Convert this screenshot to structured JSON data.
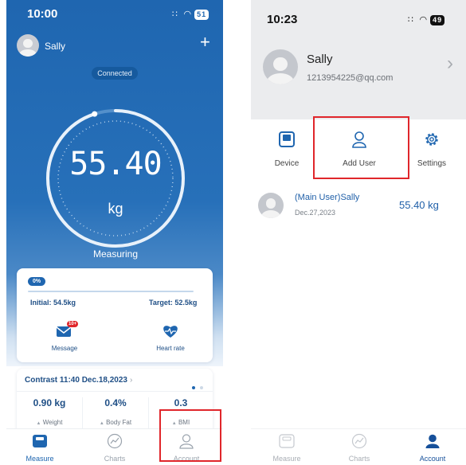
{
  "left": {
    "status": {
      "time": "10:00",
      "signal": "∷ ◠",
      "battery": "51"
    },
    "header": {
      "user_name": "Sally",
      "add_icon": "plus-icon"
    },
    "connection_status": "Connected",
    "gauge": {
      "value": "55.40",
      "unit": "kg",
      "status": "Measuring",
      "progress": 0.95
    },
    "goal": {
      "percent_badge": "0%",
      "progress": 0.0,
      "initial": "Initial: 54.5kg",
      "target": "Target: 52.5kg"
    },
    "shortcuts": [
      {
        "label": "Message",
        "badge": "10+",
        "icon": "envelope-icon"
      },
      {
        "label": "Heart rate",
        "icon": "heart-pulse-icon"
      }
    ],
    "contrast": {
      "title": "Contrast 11:40 Dec.18,2023",
      "chevron": "›",
      "metrics": [
        {
          "value": "0.90 kg",
          "label": "Weight",
          "trend": "▲"
        },
        {
          "value": "0.4%",
          "label": "Body Fat",
          "trend": "▲"
        },
        {
          "value": "0.3",
          "label": "BMI",
          "trend": "▲"
        }
      ]
    },
    "tabs": [
      {
        "label": "Measure",
        "icon": "scale-icon",
        "active": true
      },
      {
        "label": "Charts",
        "icon": "chart-icon",
        "active": false
      },
      {
        "label": "Account",
        "icon": "user-icon",
        "active": false
      }
    ]
  },
  "right": {
    "status": {
      "time": "10:23",
      "signal": "∷ ◠",
      "battery": "49"
    },
    "profile": {
      "name": "Sally",
      "email": "1213954225@qq.com",
      "chevron": "›"
    },
    "menu": [
      {
        "label": "Device",
        "icon": "device-icon"
      },
      {
        "label": "Add User",
        "icon": "user-outline-icon"
      },
      {
        "label": "Settings",
        "icon": "gear-icon"
      }
    ],
    "user_list": [
      {
        "name": "(Main User)Sally",
        "date": "Dec.27,2023",
        "weight": "55.40 kg"
      }
    ],
    "tabs": [
      {
        "label": "Measure",
        "icon": "scale-icon",
        "active": false
      },
      {
        "label": "Charts",
        "icon": "chart-icon",
        "active": false
      },
      {
        "label": "Account",
        "icon": "user-icon",
        "active": true
      }
    ]
  },
  "colors": {
    "primary": "#1f66b0",
    "highlight": "#e0262b",
    "accent_text": "#1f5fa8"
  }
}
